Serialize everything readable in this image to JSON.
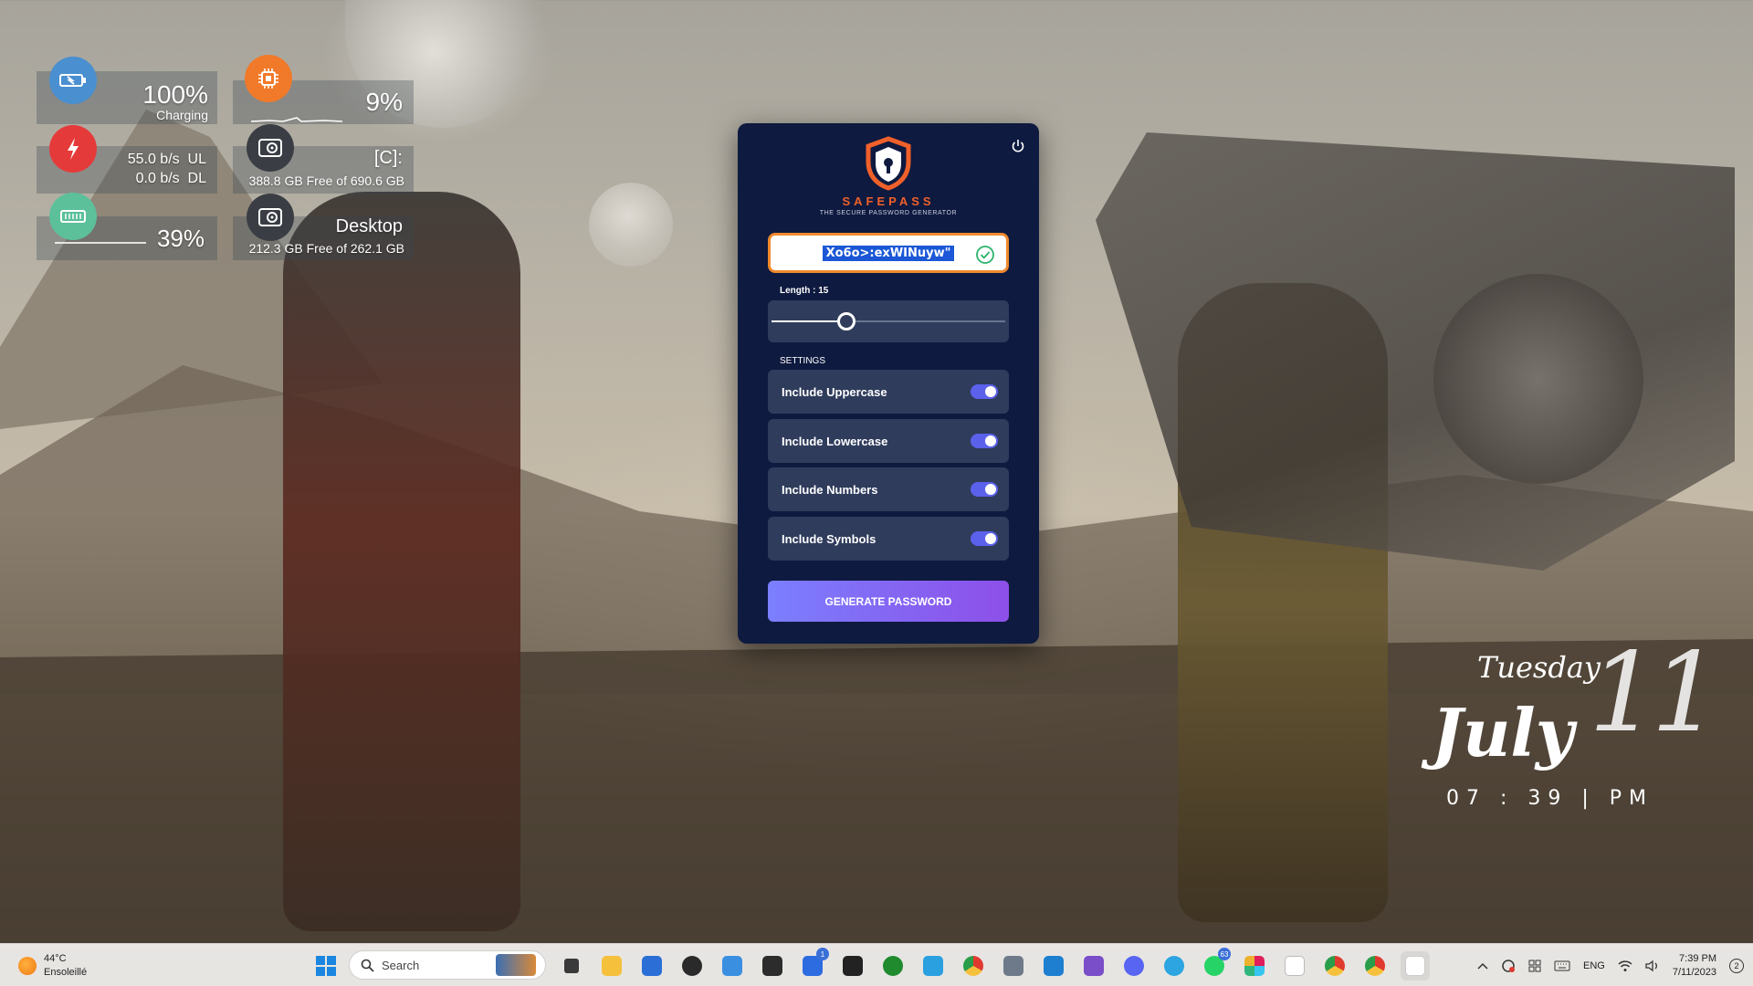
{
  "widgets": {
    "battery": {
      "value": "100%",
      "status": "Charging",
      "icon": "battery-icon",
      "color": "#4a8fd0"
    },
    "cpu": {
      "value": "9%",
      "icon": "cpu-icon",
      "color": "#f07a2a"
    },
    "network": {
      "upload": "55.0 b/s  UL",
      "download": "0.0 b/s  DL",
      "icon": "network-icon",
      "color": "#e53a3a"
    },
    "disk_c": {
      "title": "[C]:",
      "free": "388.8 GB Free of 690.6 GB",
      "icon": "drive-icon"
    },
    "ram": {
      "value": "39%",
      "icon": "ram-icon",
      "color": "#5cc09a"
    },
    "disk_desktop": {
      "title": "Desktop",
      "free": "212.3 GB Free of 262.1 GB",
      "icon": "drive-icon"
    }
  },
  "app": {
    "brand": "SAFEPASS",
    "tagline": "THE SECURE PASSWORD GENERATOR",
    "password": "Xo6o>:exWINuyw\"",
    "length_label": "Length : 15",
    "length_fraction": 0.32,
    "settings_label": "SETTINGS",
    "settings": [
      {
        "label": "Include Uppercase",
        "enabled": true
      },
      {
        "label": "Include Lowercase",
        "enabled": true
      },
      {
        "label": "Include Numbers",
        "enabled": true
      },
      {
        "label": "Include Symbols",
        "enabled": true
      }
    ],
    "generate_label": "GENERATE PASSWORD",
    "accent_color": "#5c61ec",
    "border_color": "#f08a2e"
  },
  "clock": {
    "day": "Tuesday",
    "month": "July",
    "date": "11",
    "time": "07 : 39 | PM"
  },
  "taskbar": {
    "weather_temp": "44°C",
    "weather_desc": "Ensoleillé",
    "search_placeholder": "Search",
    "badges": {
      "todo": "1",
      "whatsapp": "63"
    },
    "language": "ENG",
    "time": "7:39 PM",
    "date": "7/11/2023",
    "notifications": "2"
  }
}
